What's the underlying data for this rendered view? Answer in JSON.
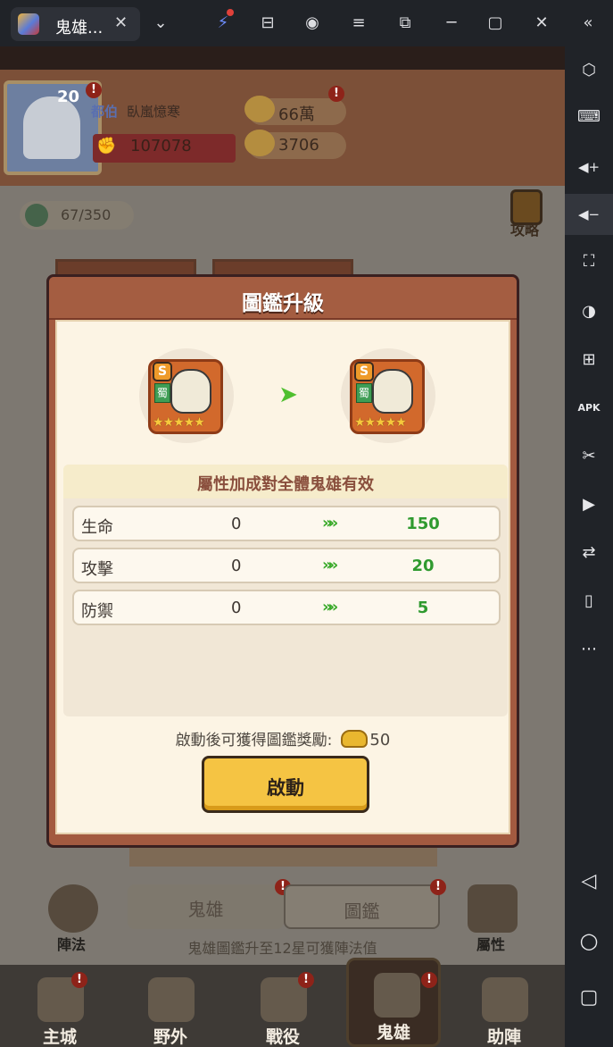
{
  "window": {
    "tab_title": "鬼雄...",
    "tab_close": "✕",
    "buttons": [
      "⌄",
      "⚡",
      "⊟",
      "◉",
      "≡",
      "⧉",
      "─",
      "▢",
      "✕",
      "«"
    ]
  },
  "sidebar": {
    "icons": [
      "gear-icon",
      "keyboard-icon",
      "volume-up-icon",
      "volume-down-icon",
      "fullscreen-icon",
      "macro-icon",
      "add-window-icon",
      "apk-icon",
      "scissors-icon",
      "record-icon",
      "sync-icon",
      "shake-icon",
      "more-icon",
      "back-icon",
      "home-icon",
      "recent-apps-icon"
    ],
    "glyphs": [
      "⬡",
      "⌨",
      "◀+",
      "◀−",
      "⛶",
      "◑",
      "⊞",
      "APK",
      "✂",
      "▶",
      "⇄",
      "▯",
      "⋯",
      "◁",
      "○",
      "▢"
    ]
  },
  "hud": {
    "level": "20",
    "alert": "!",
    "player_title": "都伯",
    "player_name": "臥嵐憶寒",
    "power": "107078",
    "gold": "66萬",
    "ingots": "3706"
  },
  "collection": {
    "count": "67/350",
    "guide_label": "攻略"
  },
  "modal": {
    "title": "圖鑑升級",
    "hero_before": {
      "grade": "S",
      "faction": "蜀",
      "stars": "★★★★★"
    },
    "hero_after": {
      "grade": "S",
      "faction": "蜀",
      "stars": "★★★★★"
    },
    "upgrade_arrow": "➤",
    "bonus_text": "屬性加成對全體鬼雄有效",
    "stats": [
      {
        "name": "生命",
        "from": "0",
        "arrow": "»»",
        "to": "150"
      },
      {
        "name": "攻擊",
        "from": "0",
        "arrow": "»»",
        "to": "20"
      },
      {
        "name": "防禦",
        "from": "0",
        "arrow": "»»",
        "to": "5"
      }
    ],
    "reward_text": "啟動後可獲得圖鑑獎勵:",
    "reward_value": "50",
    "activate_label": "啟動"
  },
  "lower": {
    "formation_label": "陣法",
    "attributes_label": "屬性",
    "subtabs": [
      "鬼雄",
      "圖鑑"
    ],
    "hint": "鬼雄圖鑑升至12星可獲陣法值"
  },
  "nav": {
    "items": [
      "主城",
      "野外",
      "戰役",
      "鬼雄",
      "助陣"
    ]
  }
}
